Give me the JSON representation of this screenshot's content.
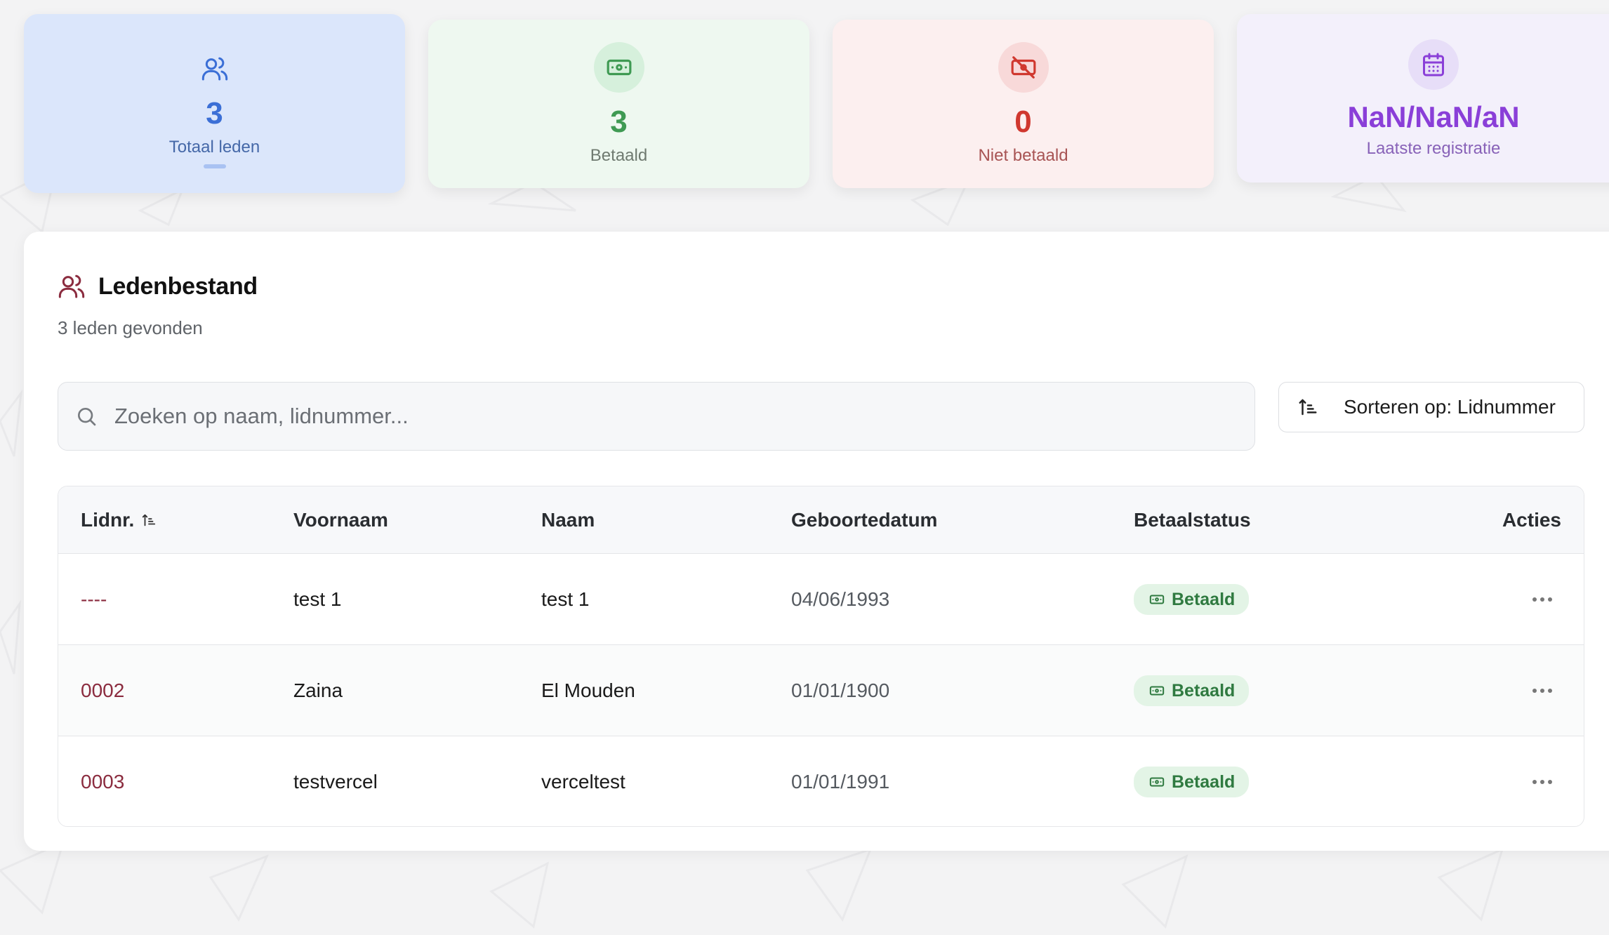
{
  "stats": {
    "total": {
      "value": "3",
      "label": "Totaal leden",
      "icon": "users-icon"
    },
    "paid": {
      "value": "3",
      "label": "Betaald",
      "icon": "banknote-icon"
    },
    "unpaid": {
      "value": "0",
      "label": "Niet betaald",
      "icon": "banknote-off-icon"
    },
    "last": {
      "value": "NaN/NaN/aN",
      "label": "Laatste registratie",
      "icon": "calendar-icon"
    }
  },
  "panel": {
    "title": "Ledenbestand",
    "subtitle": "3 leden gevonden"
  },
  "search": {
    "placeholder": "Zoeken op naam, lidnummer...",
    "value": ""
  },
  "sort": {
    "label": "Sorteren op: Lidnummer"
  },
  "table": {
    "headers": {
      "lidnr": "Lidnr.",
      "voornaam": "Voornaam",
      "naam": "Naam",
      "geboortedatum": "Geboortedatum",
      "betaalstatus": "Betaalstatus",
      "acties": "Acties"
    },
    "rows": [
      {
        "lidnr": "----",
        "voornaam": "test 1",
        "naam": "test 1",
        "geboortedatum": "04/06/1993",
        "status": "Betaald"
      },
      {
        "lidnr": "0002",
        "voornaam": "Zaina",
        "naam": "El Mouden",
        "geboortedatum": "01/01/1900",
        "status": "Betaald"
      },
      {
        "lidnr": "0003",
        "voornaam": "testvercel",
        "naam": "verceltest",
        "geboortedatum": "01/01/1991",
        "status": "Betaald"
      }
    ]
  },
  "colors": {
    "accent_blue": "#3b6fd6",
    "accent_green": "#3f9a53",
    "accent_red": "#d0382f",
    "accent_purple": "#8a3fd8",
    "lidnr": "#8b2c3f"
  }
}
